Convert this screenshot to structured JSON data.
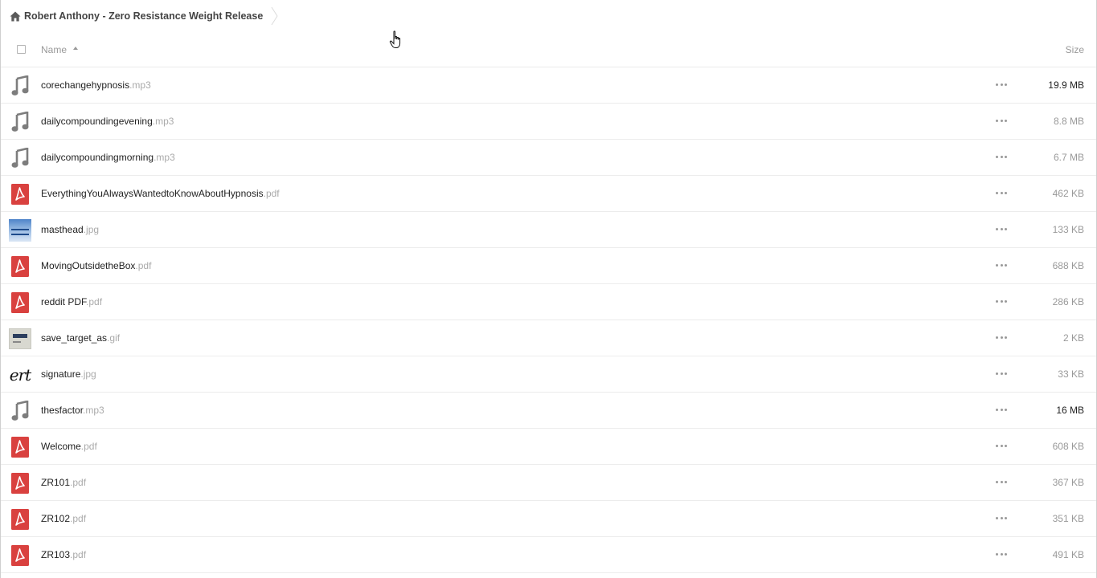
{
  "breadcrumb": {
    "title": "Robert Anthony - Zero Resistance Weight Release"
  },
  "header": {
    "name_label": "Name",
    "size_label": "Size"
  },
  "files": [
    {
      "name": "corechangehypnosis",
      "ext": ".mp3",
      "size": "19.9 MB",
      "type": "audio",
      "icon": "music-note-icon"
    },
    {
      "name": "dailycompoundingevening",
      "ext": ".mp3",
      "size": "8.8 MB",
      "type": "audio",
      "icon": "music-note-icon"
    },
    {
      "name": "dailycompoundingmorning",
      "ext": ".mp3",
      "size": "6.7 MB",
      "type": "audio",
      "icon": "music-note-icon"
    },
    {
      "name": "EverythingYouAlwaysWantedtoKnowAboutHypnosis",
      "ext": ".pdf",
      "size": "462 KB",
      "type": "pdf",
      "icon": "pdf-icon"
    },
    {
      "name": "masthead",
      "ext": ".jpg",
      "size": "133 KB",
      "type": "image-blue",
      "icon": "image-thumbnail-icon"
    },
    {
      "name": "MovingOutsidetheBox",
      "ext": ".pdf",
      "size": "688 KB",
      "type": "pdf",
      "icon": "pdf-icon"
    },
    {
      "name": "reddit PDF",
      "ext": ".pdf",
      "size": "286 KB",
      "type": "pdf",
      "icon": "pdf-icon"
    },
    {
      "name": "save_target_as",
      "ext": ".gif",
      "size": "2 KB",
      "type": "image-gray",
      "icon": "image-thumbnail-icon"
    },
    {
      "name": "signature",
      "ext": ".jpg",
      "size": "33 KB",
      "type": "signature",
      "icon": "signature-thumbnail-icon"
    },
    {
      "name": "thesfactor",
      "ext": ".mp3",
      "size": "16 MB",
      "type": "audio",
      "icon": "music-note-icon"
    },
    {
      "name": "Welcome",
      "ext": ".pdf",
      "size": "608 KB",
      "type": "pdf",
      "icon": "pdf-icon"
    },
    {
      "name": "ZR101",
      "ext": ".pdf",
      "size": "367 KB",
      "type": "pdf",
      "icon": "pdf-icon"
    },
    {
      "name": "ZR102",
      "ext": ".pdf",
      "size": "351 KB",
      "type": "pdf",
      "icon": "pdf-icon"
    },
    {
      "name": "ZR103",
      "ext": ".pdf",
      "size": "491 KB",
      "type": "pdf",
      "icon": "pdf-icon"
    }
  ],
  "colors": {
    "pdf_red": "#d9413f",
    "audio_gray": "#7d7d7d",
    "muted_text": "#999999",
    "row_border": "#ececec"
  }
}
